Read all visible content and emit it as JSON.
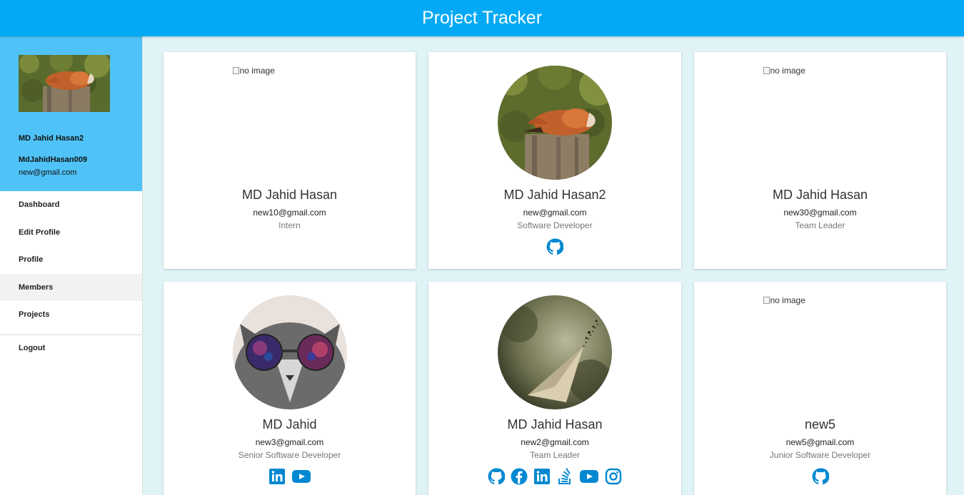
{
  "app": {
    "title": "Project Tracker"
  },
  "sidebar": {
    "name": "MD Jahid Hasan2",
    "username": "MdJahidHasan009",
    "email": "new@gmail.com",
    "nav": [
      {
        "label": "Dashboard",
        "active": false
      },
      {
        "label": "Edit Profile",
        "active": false
      },
      {
        "label": "Profile",
        "active": false
      },
      {
        "label": "Members",
        "active": true
      },
      {
        "label": "Projects",
        "active": false
      }
    ],
    "logout": "Logout"
  },
  "members": [
    {
      "name": "MD Jahid Hasan",
      "email": "new10@gmail.com",
      "role": "Intern",
      "image": "broken",
      "alt": "no image",
      "socials": []
    },
    {
      "name": "MD Jahid Hasan2",
      "email": "new@gmail.com",
      "role": "Software Developer",
      "image": "fox",
      "socials": [
        "github"
      ]
    },
    {
      "name": "MD Jahid Hasan",
      "email": "new30@gmail.com",
      "role": "Team Leader",
      "image": "broken",
      "alt": "no image",
      "socials": []
    },
    {
      "name": "MD Jahid",
      "email": "new3@gmail.com",
      "role": "Senior Software Developer",
      "image": "cat",
      "socials": [
        "linkedin",
        "youtube"
      ]
    },
    {
      "name": "MD Jahid Hasan",
      "email": "new2@gmail.com",
      "role": "Team Leader",
      "image": "paper-plane",
      "socials": [
        "github",
        "facebook",
        "linkedin",
        "stackoverflow",
        "youtube",
        "instagram"
      ]
    },
    {
      "name": "new5",
      "email": "new5@gmail.com",
      "role": "Junior Software Developer",
      "image": "broken",
      "alt": "no image",
      "socials": [
        "github"
      ]
    }
  ],
  "colors": {
    "appbar": "#03a9f4",
    "sidebar_header": "#4fc3f7",
    "background": "#e0f4f7",
    "icon": "#0288d1"
  }
}
